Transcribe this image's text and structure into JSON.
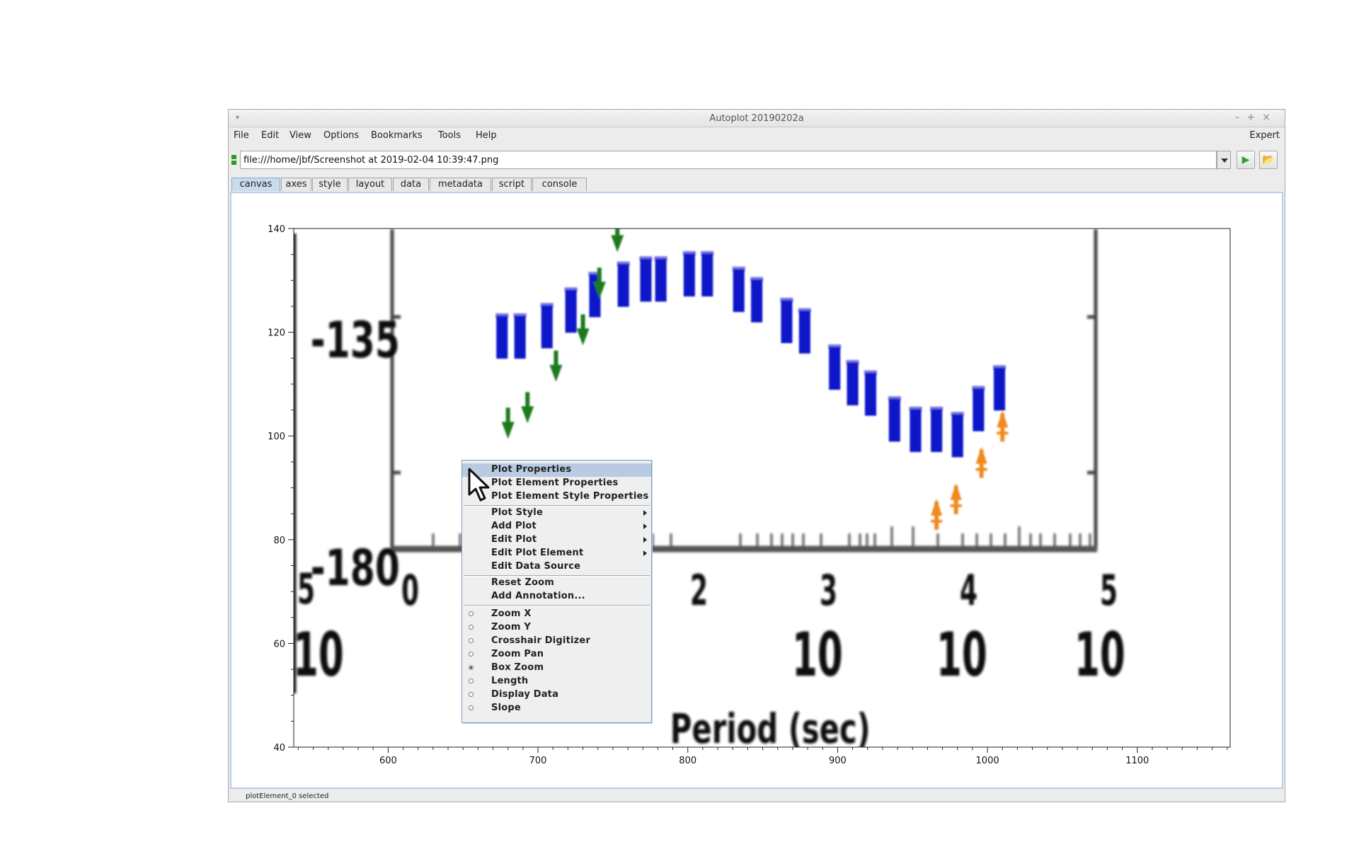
{
  "window": {
    "title": "Autoplot 20190202a"
  },
  "menubar": {
    "items": [
      "File",
      "Edit",
      "View",
      "Options",
      "Bookmarks",
      "Tools",
      "Help"
    ],
    "expert": "Expert"
  },
  "url": {
    "value": "file:///home/jbf/Screenshot at 2019-02-04 10:39:47.png"
  },
  "tabs": [
    "canvas",
    "axes",
    "style",
    "layout",
    "data",
    "metadata",
    "script",
    "console"
  ],
  "active_tab": "canvas",
  "status": {
    "text": "plotElement_0 selected"
  },
  "plot": {
    "background_image_text": {
      "y_tick_135": "-135",
      "y_tick_180": "-180",
      "x_tick_exponents": [
        "5",
        "0",
        "2",
        "3",
        "4",
        "5"
      ],
      "x_tick_base": "10",
      "xlabel": "Period (sec)"
    }
  },
  "chart_data": {
    "type": "scatter",
    "title": "",
    "xlabel": "",
    "ylabel": "",
    "xlim": [
      537,
      1162
    ],
    "ylim": [
      40,
      140
    ],
    "x_ticks": [
      600,
      700,
      800,
      900,
      1000,
      1100
    ],
    "y_ticks": [
      40,
      60,
      80,
      100,
      120,
      140
    ],
    "grid": false,
    "series": [
      {
        "color": "#0b12c8",
        "marker": "bar",
        "x": [
          676,
          688,
          706,
          722,
          738,
          757,
          772,
          782,
          801,
          813,
          834,
          846,
          866,
          878,
          898,
          910,
          922,
          938,
          952,
          966,
          980,
          994,
          1008
        ],
        "y": [
          119,
          119,
          121,
          124,
          127,
          129,
          130,
          130,
          131,
          131,
          128,
          126,
          122,
          120,
          113,
          110,
          108,
          103,
          101,
          101,
          100,
          105,
          109
        ]
      },
      {
        "color": "#1b7a1b",
        "marker": "arrow-down",
        "x": [
          680,
          693,
          712,
          730,
          741,
          753
        ],
        "y": [
          100,
          103,
          111,
          118,
          127,
          136
        ]
      },
      {
        "color": "#f08a1a",
        "marker": "arrow-up",
        "x": [
          966,
          979,
          996,
          1010
        ],
        "y": [
          86,
          89,
          96,
          103
        ]
      }
    ]
  },
  "context_menu": {
    "items": [
      {
        "label": "Plot Properties",
        "selected": true
      },
      {
        "label": "Plot Element Properties"
      },
      {
        "label": "Plot Element Style Properties"
      },
      {
        "label": "Plot Style",
        "submenu": true
      },
      {
        "label": "Add Plot",
        "submenu": true
      },
      {
        "label": "Edit Plot",
        "submenu": true
      },
      {
        "label": "Edit Plot Element",
        "submenu": true
      },
      {
        "label": "Edit Data Source"
      },
      {
        "label": "Reset Zoom"
      },
      {
        "label": "Add Annotation..."
      },
      {
        "label": "Zoom X",
        "radio": true,
        "checked": false
      },
      {
        "label": "Zoom Y",
        "radio": true,
        "checked": false
      },
      {
        "label": "Crosshair Digitizer",
        "radio": true,
        "checked": false
      },
      {
        "label": "Zoom Pan",
        "radio": true,
        "checked": false
      },
      {
        "label": "Box Zoom",
        "radio": true,
        "checked": true
      },
      {
        "label": "Length",
        "radio": true,
        "checked": false
      },
      {
        "label": "Display Data",
        "radio": true,
        "checked": false
      },
      {
        "label": "Slope",
        "radio": true,
        "checked": false
      }
    ]
  }
}
